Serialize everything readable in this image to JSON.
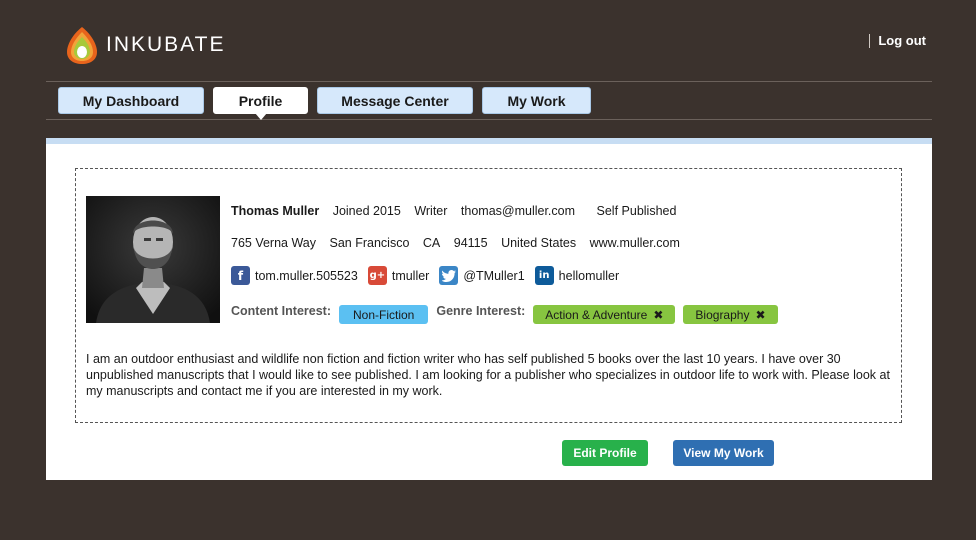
{
  "header": {
    "brand": "INKUBATE",
    "logout_label": "Log out"
  },
  "nav": {
    "tabs": [
      {
        "label": "My Dashboard",
        "active": false
      },
      {
        "label": "Profile",
        "active": true
      },
      {
        "label": "Message Center",
        "active": false
      },
      {
        "label": "My Work",
        "active": false
      }
    ]
  },
  "profile": {
    "name": "Thomas Muller",
    "joined": "Joined 2015",
    "role": "Writer",
    "email": "thomas@muller.com",
    "status": "Self Published",
    "street": "765 Verna Way",
    "city": "San Francisco",
    "state": "CA",
    "zip": "94115",
    "country": "United States",
    "website": "www.muller.com",
    "social": {
      "facebook": "tom.muller.505523",
      "googleplus": "tmuller",
      "twitter": "@TMuller1",
      "linkedin": "hellomuller"
    },
    "content_interest_label": "Content Interest:",
    "content_interests": [
      "Non-Fiction"
    ],
    "genre_interest_label": "Genre Interest:",
    "genre_interests": [
      "Action & Adventure",
      "Biography"
    ],
    "bio": "I am an outdoor enthusiast and wildlife non fiction and fiction writer who has self published 5 books over the last 10 years. I have over 30 unpublished manuscripts that I would like to see published. I am looking for a publisher who specializes in outdoor life to work with. Please look at my manuscripts and contact me if you are interested in my work."
  },
  "actions": {
    "edit_label": "Edit Profile",
    "view_label": "View My Work"
  },
  "icons": {
    "remove": "close-icon",
    "facebook": "facebook-icon",
    "googleplus": "google-plus-icon",
    "twitter": "twitter-icon",
    "linkedin": "linkedin-icon"
  },
  "colors": {
    "background": "#3b322d",
    "tab": "#d6e8fb",
    "content_pill": "#5bc0f2",
    "genre_pill": "#87c540",
    "edit_button": "#28b14b",
    "view_button": "#2f6fb2"
  }
}
